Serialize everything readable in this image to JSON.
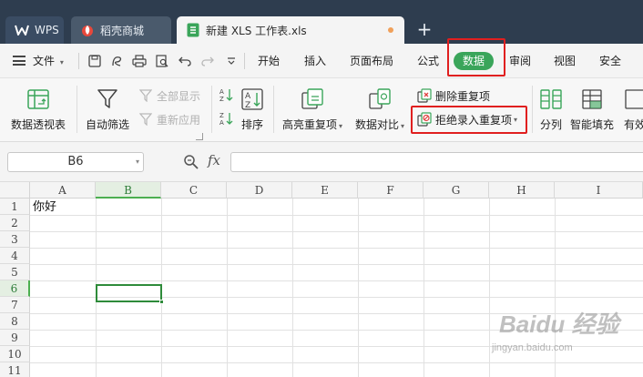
{
  "tabs": [
    {
      "label": "WPS",
      "icon": "wps-logo-icon"
    },
    {
      "label": "稻壳商城",
      "icon": "docer-flame-icon"
    },
    {
      "label": "新建 XLS 工作表.xls",
      "icon": "sheet-file-icon"
    }
  ],
  "menu": {
    "file_label": "文件",
    "items": [
      "开始",
      "插入",
      "页面布局",
      "公式",
      "数据",
      "审阅",
      "视图",
      "安全"
    ],
    "active": "数据"
  },
  "ribbon": {
    "pivot": "数据透视表",
    "autofilter": "自动筛选",
    "show_all": "全部显示",
    "reapply": "重新应用",
    "sort": "排序",
    "highlight_dup": "高亮重复项",
    "compare": "数据对比",
    "remove_dup": "删除重复项",
    "reject_dup": "拒绝录入重复项",
    "split": "分列",
    "fill": "智能填充",
    "valid": "有效"
  },
  "formula": {
    "cell_ref": "B6",
    "fx": "fx",
    "value": ""
  },
  "grid": {
    "columns": [
      "A",
      "B",
      "C",
      "D",
      "E",
      "F",
      "G",
      "H",
      "I"
    ],
    "rows": [
      "1",
      "2",
      "3",
      "4",
      "5",
      "6",
      "7",
      "8",
      "9",
      "10",
      "11"
    ],
    "active_col": "B",
    "active_row": "6",
    "cells": {
      "A1": "你好"
    }
  },
  "watermark": {
    "main": "Baidu 经验",
    "sub": "jingyan.baidu.com"
  },
  "colors": {
    "accent": "#3aa55a",
    "highlight": "#e01f1f",
    "tabbar": "#2e3d4f"
  }
}
